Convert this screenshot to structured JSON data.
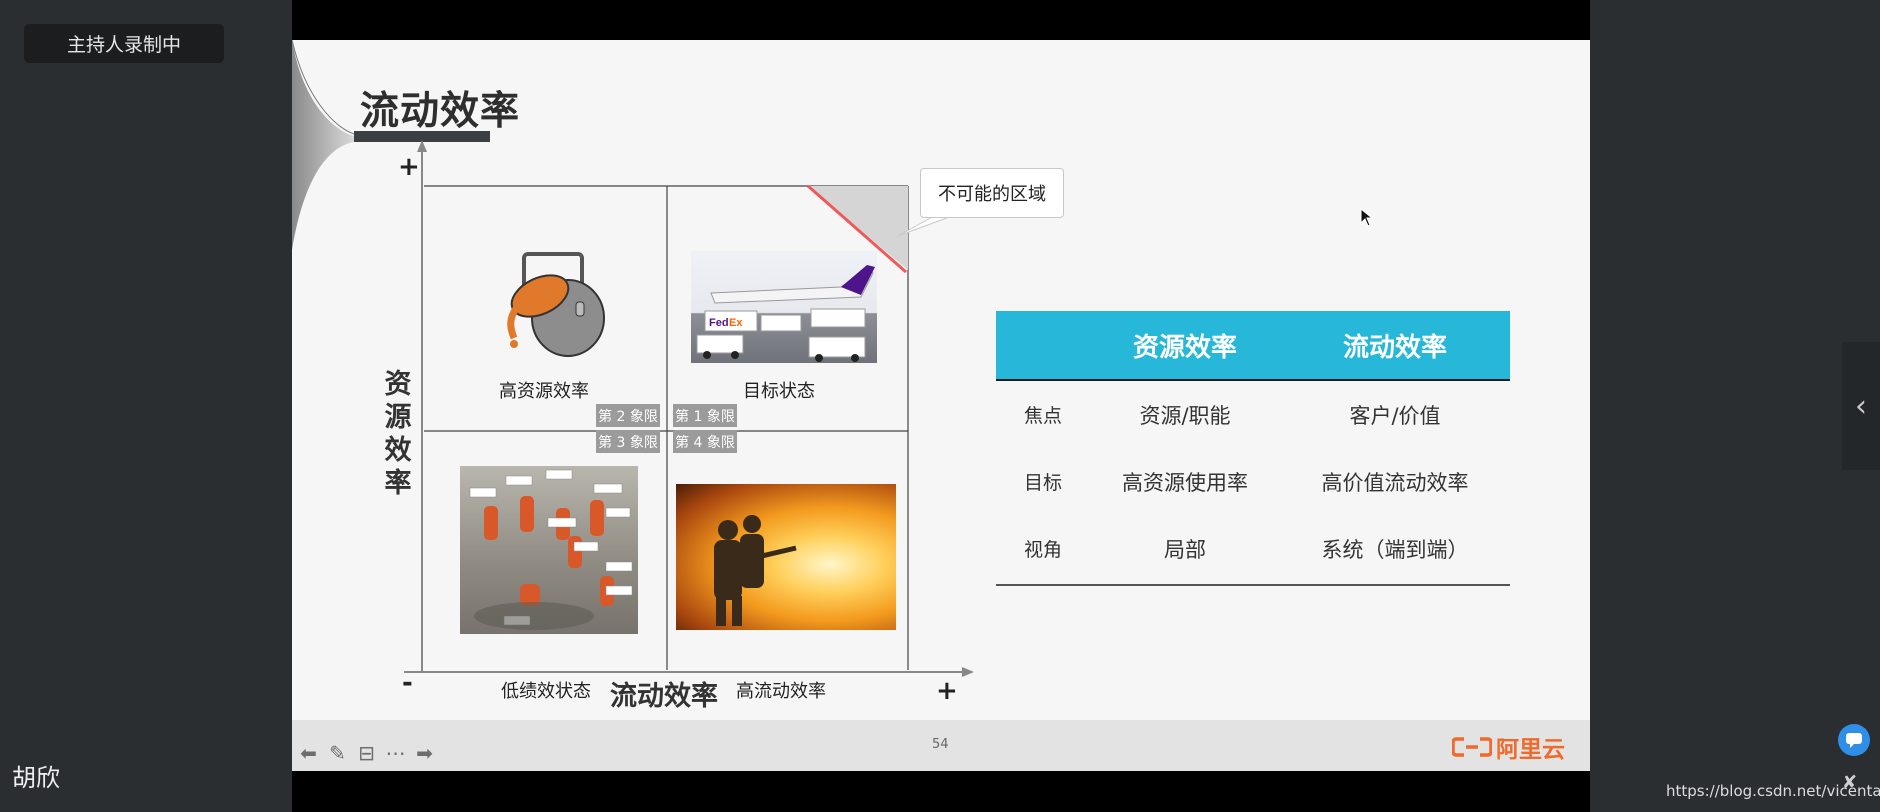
{
  "recording_badge": "主持人录制中",
  "presenter_name": "胡欣",
  "watermark_url": "https://blog.csdn.net/vicentan",
  "slide": {
    "title": "流动效率",
    "page_number": "54",
    "logo_text": "阿里云",
    "accent_color": "#27b7d8",
    "logo_color": "#f06b2b"
  },
  "matrix": {
    "y_axis_label": "资源效率",
    "x_axis_label": "流动效率",
    "y_plus": "+",
    "x_minus": "-",
    "x_plus": "+",
    "callout": "不可能的区域",
    "quadrants": {
      "top_left": "高资源效率",
      "top_right": "目标状态",
      "bottom_left": "低绩效状态",
      "bottom_right": "高流动效率"
    },
    "tags": {
      "q2": "第 2 象限",
      "q1": "第 1 象限",
      "q3": "第 3 象限",
      "q4": "第 4 象限"
    }
  },
  "comparison": {
    "headers": [
      "",
      "资源效率",
      "流动效率"
    ],
    "rows": [
      {
        "key": "焦点",
        "resource": "资源/职能",
        "flow": "客户/价值"
      },
      {
        "key": "目标",
        "resource": "高资源使用率",
        "flow": "高价值流动效率"
      },
      {
        "key": "视角",
        "resource": "局部",
        "flow": "系统（端到端）"
      }
    ]
  },
  "toolbar_icons": [
    "back-arrow-icon",
    "pen-icon",
    "subtitle-icon",
    "more-icon",
    "forward-arrow-icon"
  ]
}
